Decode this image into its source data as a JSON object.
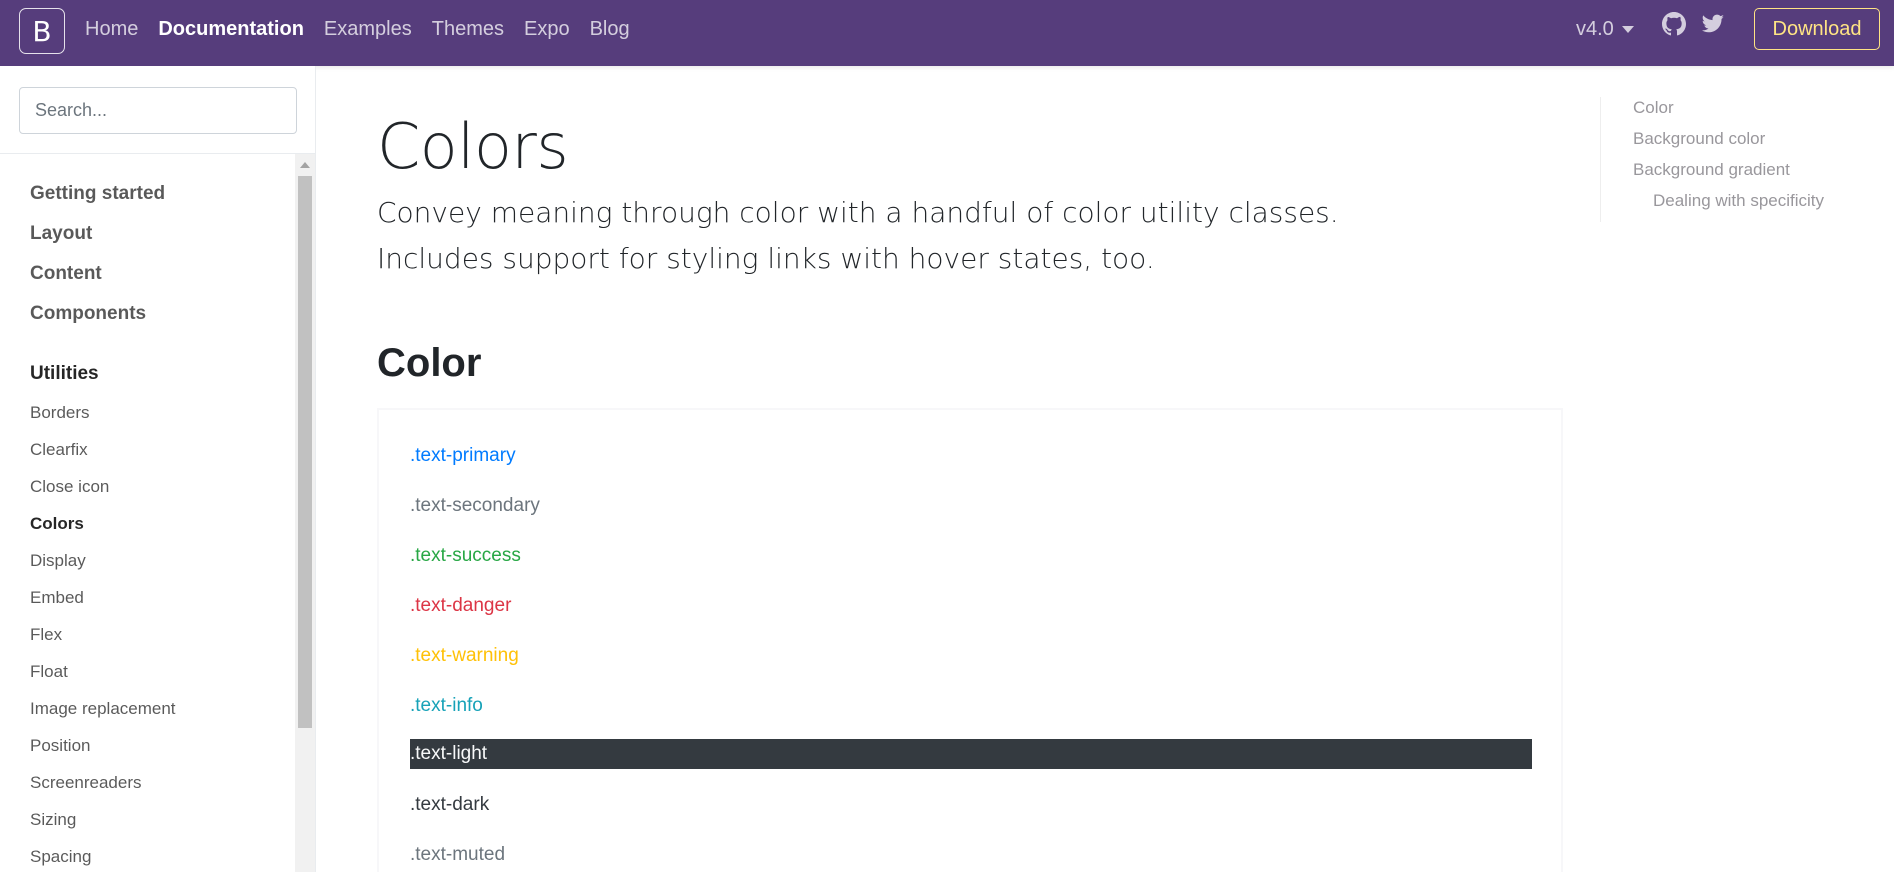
{
  "navbar": {
    "brand": "B",
    "links": [
      {
        "label": "Home",
        "active": false
      },
      {
        "label": "Documentation",
        "active": true
      },
      {
        "label": "Examples",
        "active": false
      },
      {
        "label": "Themes",
        "active": false
      },
      {
        "label": "Expo",
        "active": false
      },
      {
        "label": "Blog",
        "active": false
      }
    ],
    "version": "v4.0",
    "download": "Download",
    "icons": [
      "github-icon",
      "twitter-icon"
    ],
    "colors": {
      "background": "#563d7c",
      "download": "#ffe484"
    }
  },
  "sidebar": {
    "search_placeholder": "Search...",
    "groups": [
      "Getting started",
      "Layout",
      "Content",
      "Components",
      "Utilities"
    ],
    "utilities": [
      "Borders",
      "Clearfix",
      "Close icon",
      "Colors",
      "Display",
      "Embed",
      "Flex",
      "Float",
      "Image replacement",
      "Position",
      "Screenreaders",
      "Sizing",
      "Spacing"
    ],
    "active_item": "Colors"
  },
  "main": {
    "title": "Colors",
    "lead": "Convey meaning through color with a handful of color utility classes. Includes support for styling links with hover states, too.",
    "section": "Color",
    "swatches": [
      {
        "label": ".text-primary",
        "color": "#007bff"
      },
      {
        "label": ".text-secondary",
        "color": "#6c757d"
      },
      {
        "label": ".text-success",
        "color": "#28a745"
      },
      {
        "label": ".text-danger",
        "color": "#dc3545"
      },
      {
        "label": ".text-warning",
        "color": "#ffc107"
      },
      {
        "label": ".text-info",
        "color": "#17a2b8"
      },
      {
        "label": ".text-light",
        "color": "#f8f9fa",
        "background": "#343a40"
      },
      {
        "label": ".text-dark",
        "color": "#343a40"
      },
      {
        "label": ".text-muted",
        "color": "#6c757d"
      }
    ]
  },
  "toc": {
    "items": [
      {
        "label": "Color",
        "nested": false
      },
      {
        "label": "Background color",
        "nested": false
      },
      {
        "label": "Background gradient",
        "nested": false
      },
      {
        "label": "Dealing with specificity",
        "nested": true
      }
    ]
  }
}
